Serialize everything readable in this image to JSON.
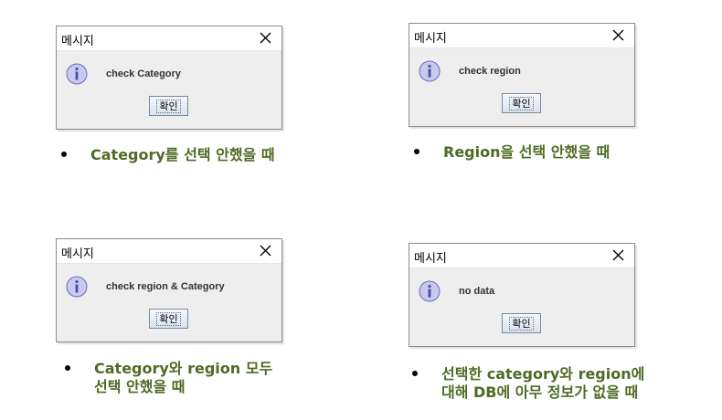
{
  "dialogs": [
    {
      "title": "메시지",
      "message": "check Category",
      "ok_label": "확인",
      "caption_lines": [
        "Category를 선택 안했을 때"
      ]
    },
    {
      "title": "메시지",
      "message": "check region",
      "ok_label": "확인",
      "caption_lines": [
        "Region을 선택 안했을 때"
      ]
    },
    {
      "title": "메시지",
      "message": "check region & Category",
      "ok_label": "확인",
      "caption_lines": [
        "Category와 region 모두",
        "선택 안했을 때"
      ]
    },
    {
      "title": "메시지",
      "message": "no data",
      "ok_label": "확인",
      "caption_lines": [
        "선택한 category와 region에",
        "대해 DB에 아무 정보가 없을 때"
      ]
    }
  ],
  "colors": {
    "caption": "#4e6b24",
    "dialog_bg": "#eeeeee",
    "icon_fill": "#c9c9ee",
    "icon_stroke": "#6b6bbf"
  },
  "icons": {
    "info": "info-icon",
    "close": "close-icon",
    "bullet": "bullet-icon"
  }
}
